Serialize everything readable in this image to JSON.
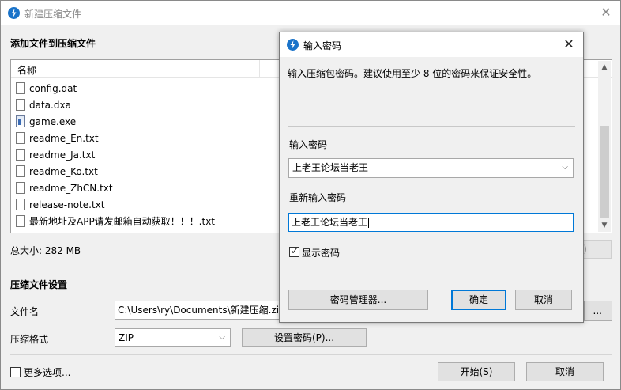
{
  "window": {
    "title": "新建压缩文件"
  },
  "add_section": {
    "heading": "添加文件到压缩文件"
  },
  "file_list": {
    "column_name": "名称",
    "files": [
      {
        "name": "config.dat",
        "icon": "file-icon"
      },
      {
        "name": "data.dxa",
        "icon": "file-icon"
      },
      {
        "name": "game.exe",
        "icon": "exe-icon"
      },
      {
        "name": "readme_En.txt",
        "icon": "file-icon"
      },
      {
        "name": "readme_Ja.txt",
        "icon": "file-icon"
      },
      {
        "name": "readme_Ko.txt",
        "icon": "file-icon"
      },
      {
        "name": "readme_ZhCN.txt",
        "icon": "file-icon"
      },
      {
        "name": "release-note.txt",
        "icon": "file-icon"
      },
      {
        "name": "最新地址及APP请发邮箱自动获取！！！.txt",
        "icon": "file-icon"
      }
    ]
  },
  "total_size": "总大小: 282 MB",
  "hidden_button_fragment": ")",
  "settings": {
    "heading": "压缩文件设置",
    "filename_label": "文件名",
    "filename_value": "C:\\Users\\ry\\Documents\\新建压缩.zip",
    "browse_fragment": "...",
    "format_label": "压缩格式",
    "format_value": "ZIP",
    "set_password_button": "设置密码(P)..."
  },
  "footer": {
    "more_options": "更多选项...",
    "start_button": "开始(S)",
    "cancel_button": "取消"
  },
  "dialog": {
    "title": "输入密码",
    "description": "输入压缩包密码。建议使用至少 8 位的密码来保证安全性。",
    "password_label": "输入密码",
    "password_value": "上老王论坛当老王",
    "confirm_label": "重新输入密码",
    "confirm_value": "上老王论坛当老王",
    "show_password_label": "显示密码",
    "show_password_checked": true,
    "manager_button": "密码管理器...",
    "ok_button": "确定",
    "cancel_button": "取消"
  },
  "colors": {
    "accent": "#0078d7",
    "app_icon": "#1a73c9"
  }
}
